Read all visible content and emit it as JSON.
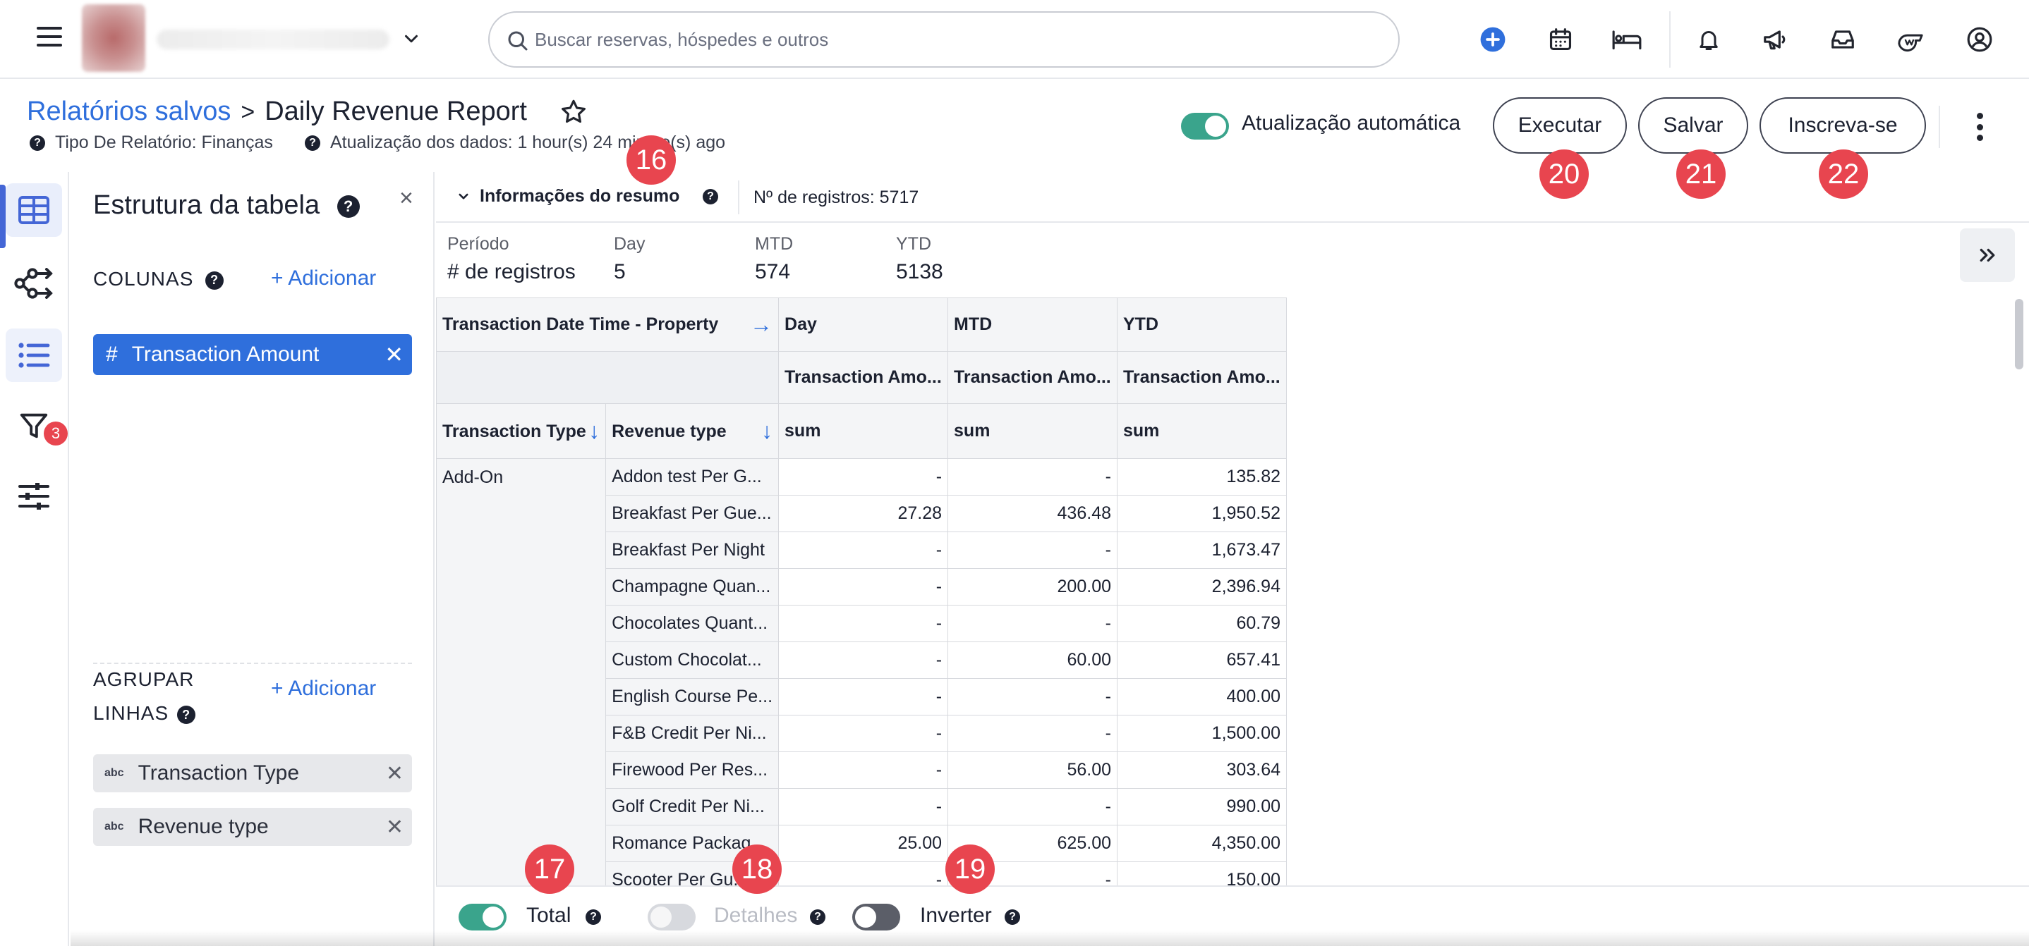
{
  "topbar": {
    "search_placeholder": "Buscar reservas, hóspedes e outros",
    "icons": [
      "menu-icon",
      "chevron-down-icon",
      "search-icon",
      "add-circle-icon",
      "calendar-icon",
      "bed-icon",
      "bell-icon",
      "megaphone-icon",
      "inbox-icon",
      "whistle-icon",
      "account-icon"
    ],
    "accent_color": "#2f6fdc"
  },
  "header": {
    "breadcrumb_parent": "Relatórios salvos",
    "breadcrumb_separator": ">",
    "title": "Daily Revenue Report",
    "report_type": "Tipo De Relatório: Finanças",
    "data_update": "Atualização dos dados: 1 hour(s) 24 minute(s) ago",
    "auto_update_label": "Atualização automática",
    "auto_update_on": true,
    "buttons": {
      "run": "Executar",
      "save": "Salvar",
      "subscribe": "Inscreva-se"
    }
  },
  "badges": {
    "b16": "16",
    "b17": "17",
    "b18": "18",
    "b19": "19",
    "b20": "20",
    "b21": "21",
    "b22": "22"
  },
  "rail": {
    "filter_count": "3"
  },
  "panel": {
    "title": "Estrutura da tabela",
    "close": "×",
    "columns_label": "COLUNAS",
    "columns_add": "+ Adicionar",
    "column_chip": "Transaction Amount",
    "group_label_1": "AGRUPAR",
    "group_label_2": "LINHAS",
    "group_add": "+ Adicionar",
    "group_chips": [
      "Transaction Type",
      "Revenue type"
    ],
    "abc": "abc"
  },
  "summary": {
    "toggle_label": "Informações do resumo",
    "record_count": "Nº de registros: 5717",
    "stats": [
      {
        "label": "Período",
        "value": "# de registros"
      },
      {
        "label": "Day",
        "value": "5"
      },
      {
        "label": "MTD",
        "value": "574"
      },
      {
        "label": "YTD",
        "value": "5138"
      }
    ]
  },
  "table": {
    "header_pivot": "Transaction Date Time - Property",
    "periods": [
      "Day",
      "MTD",
      "YTD"
    ],
    "measure": "Transaction Amo...",
    "agg": "sum",
    "row_header_1": "Transaction Type",
    "row_header_2": "Revenue type",
    "transaction_type": "Add-On",
    "rows": [
      {
        "revenue_type": "Addon test Per G...",
        "day": "-",
        "mtd": "-",
        "ytd": "135.82"
      },
      {
        "revenue_type": "Breakfast Per Gue...",
        "day": "27.28",
        "mtd": "436.48",
        "ytd": "1,950.52"
      },
      {
        "revenue_type": "Breakfast Per Night",
        "day": "-",
        "mtd": "-",
        "ytd": "1,673.47"
      },
      {
        "revenue_type": "Champagne Quan...",
        "day": "-",
        "mtd": "200.00",
        "ytd": "2,396.94"
      },
      {
        "revenue_type": "Chocolates Quant...",
        "day": "-",
        "mtd": "-",
        "ytd": "60.79"
      },
      {
        "revenue_type": "Custom Chocolat...",
        "day": "-",
        "mtd": "60.00",
        "ytd": "657.41"
      },
      {
        "revenue_type": "English Course Pe...",
        "day": "-",
        "mtd": "-",
        "ytd": "400.00"
      },
      {
        "revenue_type": "F&B Credit Per Ni...",
        "day": "-",
        "mtd": "-",
        "ytd": "1,500.00"
      },
      {
        "revenue_type": "Firewood Per Res...",
        "day": "-",
        "mtd": "56.00",
        "ytd": "303.64"
      },
      {
        "revenue_type": "Golf Credit Per Ni...",
        "day": "-",
        "mtd": "-",
        "ytd": "990.00"
      },
      {
        "revenue_type": "Romance Packag...",
        "day": "25.00",
        "mtd": "625.00",
        "ytd": "4,350.00"
      },
      {
        "revenue_type": "Scooter Per Gu...",
        "day": "-",
        "mtd": "-",
        "ytd": "150.00"
      }
    ]
  },
  "bottom": {
    "total_label": "Total",
    "total_on": true,
    "details_label": "Detalhes",
    "details_enabled": false,
    "invert_label": "Inverter",
    "invert_on": false
  }
}
